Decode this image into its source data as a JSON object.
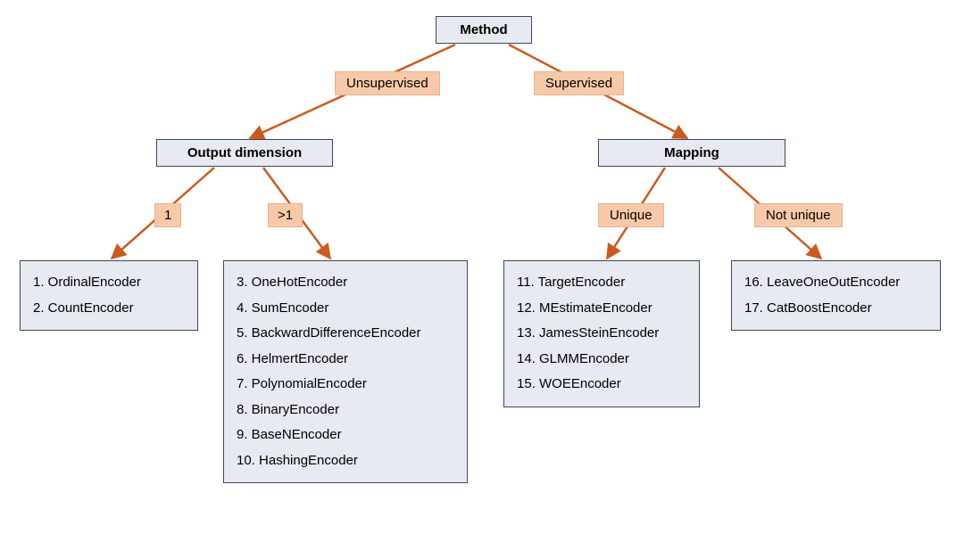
{
  "root": "Method",
  "branches": {
    "left": {
      "edge_label": "Unsupervised",
      "node": "Output dimension",
      "children": {
        "left": {
          "edge_label": "1",
          "items": [
            "1. OrdinalEncoder",
            "2. CountEncoder"
          ]
        },
        "right": {
          "edge_label": ">1",
          "items": [
            "3. OneHotEncoder",
            "4. SumEncoder",
            "5. BackwardDifferenceEncoder",
            "6. HelmertEncoder",
            "7. PolynomialEncoder",
            "8. BinaryEncoder",
            "9. BaseNEncoder",
            "10. HashingEncoder"
          ]
        }
      }
    },
    "right": {
      "edge_label": "Supervised",
      "node": "Mapping",
      "children": {
        "left": {
          "edge_label": "Unique",
          "items": [
            "11. TargetEncoder",
            "12. MEstimateEncoder",
            "13. JamesSteinEncoder",
            "14. GLMMEncoder",
            "15. WOEEncoder"
          ]
        },
        "right": {
          "edge_label": "Not unique",
          "items": [
            "16. LeaveOneOutEncoder",
            "17. CatBoostEncoder"
          ]
        }
      }
    }
  }
}
